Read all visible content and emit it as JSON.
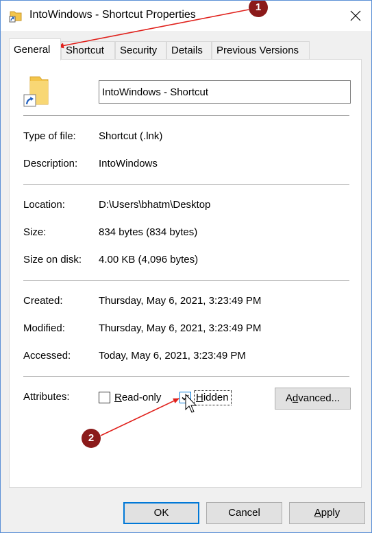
{
  "window": {
    "title": "IntoWindows - Shortcut Properties",
    "close_icon": "close-icon",
    "title_icon": "shortcut-folder-icon"
  },
  "tabs": [
    {
      "label": "General",
      "active": true
    },
    {
      "label": "Shortcut",
      "active": false
    },
    {
      "label": "Security",
      "active": false
    },
    {
      "label": "Details",
      "active": false
    },
    {
      "label": "Previous Versions",
      "active": false
    }
  ],
  "general": {
    "name_value": "IntoWindows - Shortcut",
    "type_label": "Type of file:",
    "type_value": "Shortcut (.lnk)",
    "description_label": "Description:",
    "description_value": "IntoWindows",
    "location_label": "Location:",
    "location_value": "D:\\Users\\bhatm\\Desktop",
    "size_label": "Size:",
    "size_value": "834 bytes (834 bytes)",
    "size_on_disk_label": "Size on disk:",
    "size_on_disk_value": "4.00 KB (4,096 bytes)",
    "created_label": "Created:",
    "created_value": "Thursday, May 6, 2021, 3:23:49 PM",
    "modified_label": "Modified:",
    "modified_value": "Thursday, May 6, 2021, 3:23:49 PM",
    "accessed_label": "Accessed:",
    "accessed_value": "Today, May 6, 2021, 3:23:49 PM",
    "attributes_label": "Attributes:",
    "readonly_label_prefix": "R",
    "readonly_label_rest": "ead-only",
    "readonly_checked": false,
    "hidden_label_prefix": "H",
    "hidden_label_rest": "idden",
    "hidden_checked": true,
    "advanced_label_prefix": "A",
    "advanced_label_mid": "d",
    "advanced_label_rest": "vanced..."
  },
  "buttons": {
    "ok": "OK",
    "cancel": "Cancel",
    "apply_prefix": "A",
    "apply_rest": "pply"
  },
  "annotations": [
    {
      "number": "1"
    },
    {
      "number": "2"
    }
  ],
  "colors": {
    "accent": "#0078d7",
    "annotation": "#8b1a1a",
    "arrow": "#e0201b",
    "folder": "#f3c54b"
  }
}
